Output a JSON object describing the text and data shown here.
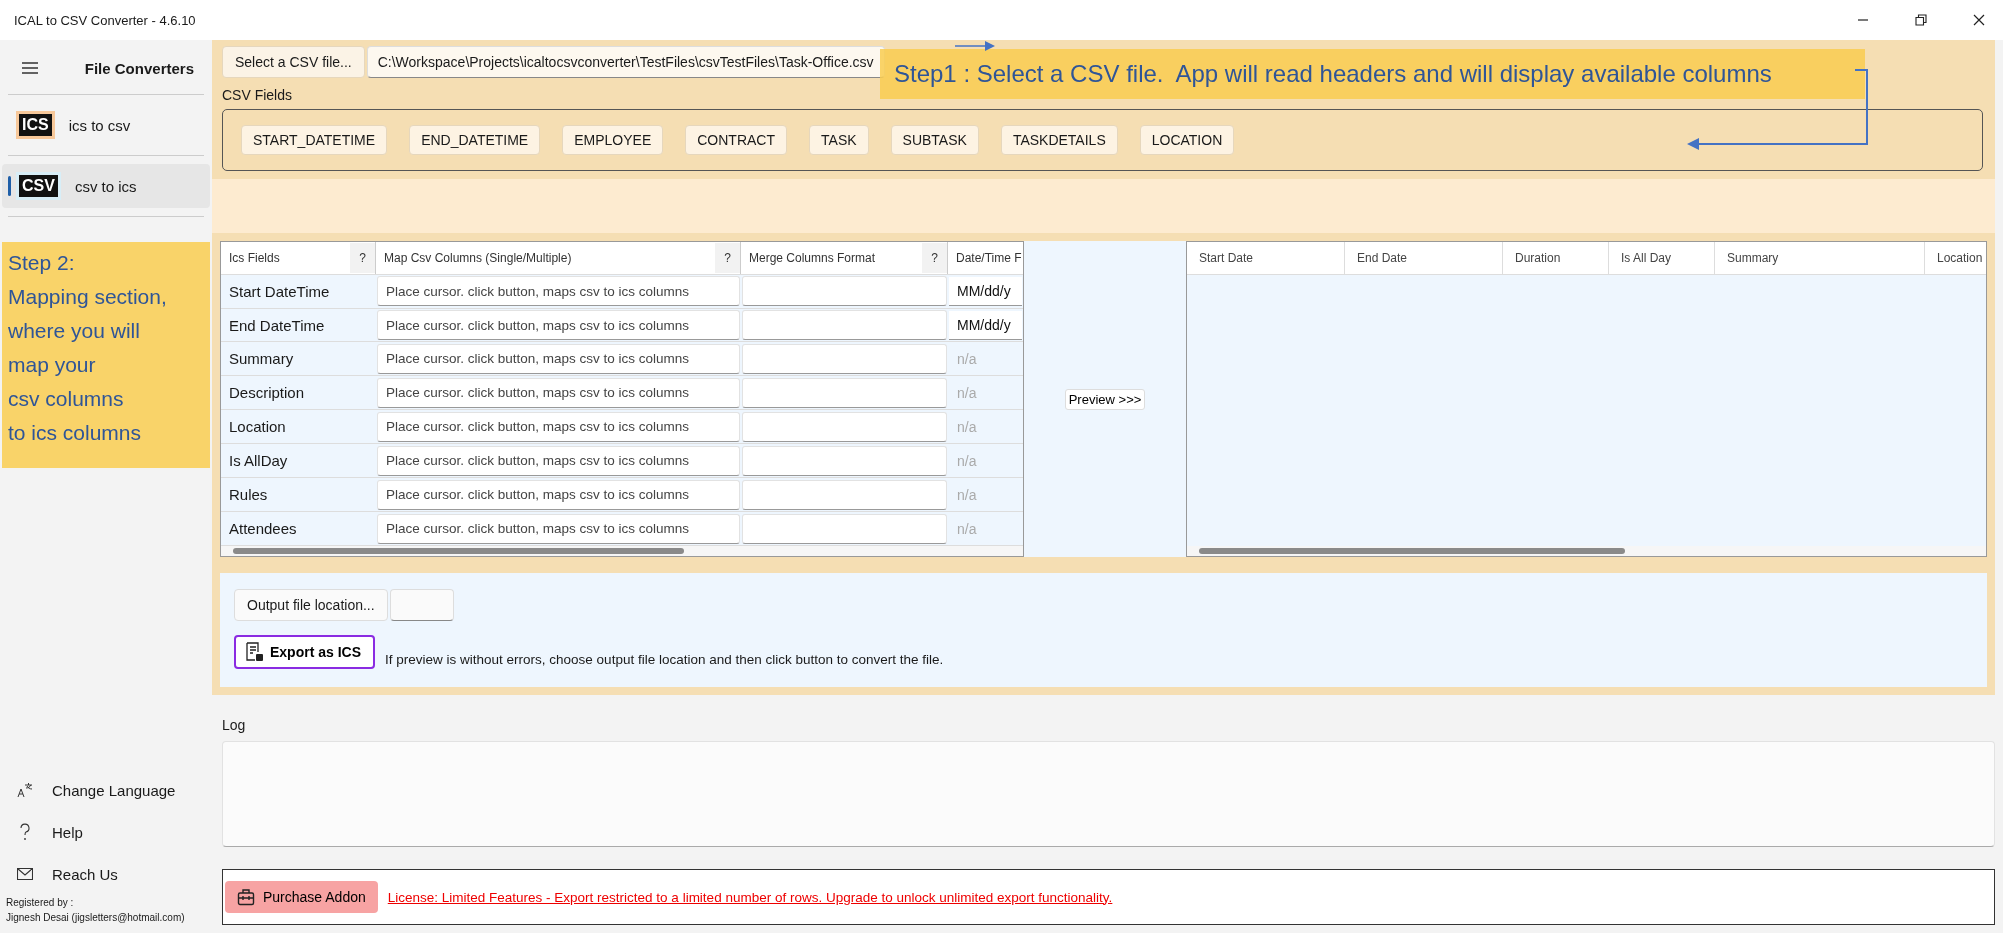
{
  "window": {
    "title": "ICAL to CSV Converter -  4.6.10"
  },
  "sidebar": {
    "title": "File Converters",
    "items": [
      {
        "label": "ics to csv",
        "badge": "ICS",
        "selected": false
      },
      {
        "label": "csv to ics",
        "badge": "CSV",
        "selected": true
      }
    ],
    "footer_items": [
      "Change Language",
      "Help",
      "Reach Us"
    ],
    "registered": [
      "Registered by :",
      "Jignesh Desai (jigsletters@hotmail.com)"
    ]
  },
  "file": {
    "button": "Select a CSV file...",
    "path": "C:\\Workspace\\Projects\\icaltocsvconverter\\TestFiles\\csvTestFiles\\Task-Office.csv"
  },
  "csv_fields": {
    "label": "CSV Fields",
    "chips": [
      "START_DATETIME",
      "END_DATETIME",
      "EMPLOYEE",
      "CONTRACT",
      "TASK",
      "SUBTASK",
      "TASKDETAILS",
      "LOCATION"
    ]
  },
  "callouts": [
    {
      "lines": [
        "Step1 : Select a CSV file.  App will read headers and will display available columns"
      ]
    },
    {
      "lines": [
        "Step 2:",
        "Mapping section,",
        "where you will",
        "map your",
        "csv columns",
        "to ics columns"
      ]
    }
  ],
  "mapping": {
    "columns": [
      {
        "label": "Ics Fields",
        "help": "?"
      },
      {
        "label": "Map Csv Columns (Single/Multiple)",
        "help": "?"
      },
      {
        "label": "Merge Columns Format",
        "help": "?"
      },
      {
        "label": "Date/Time F"
      }
    ],
    "rows": [
      {
        "field": "Start DateTime",
        "placeholder": "Place cursor. click button, maps csv to ics columns",
        "format": "MM/dd/y",
        "disabled": false
      },
      {
        "field": "End DateTime",
        "placeholder": "Place cursor. click button, maps csv to ics columns",
        "format": "MM/dd/y",
        "disabled": false
      },
      {
        "field": "Summary",
        "placeholder": "Place cursor. click button, maps csv to ics columns",
        "format": "n/a",
        "disabled": true
      },
      {
        "field": "Description",
        "placeholder": "Place cursor. click button, maps csv to ics columns",
        "format": "n/a",
        "disabled": true
      },
      {
        "field": "Location",
        "placeholder": "Place cursor. click button, maps csv to ics columns",
        "format": "n/a",
        "disabled": true
      },
      {
        "field": "Is AllDay",
        "placeholder": "Place cursor. click button, maps csv to ics columns",
        "format": "n/a",
        "disabled": true
      },
      {
        "field": "Rules",
        "placeholder": "Place cursor. click button, maps csv to ics columns",
        "format": "n/a",
        "disabled": true
      },
      {
        "field": "Attendees",
        "placeholder": "Place cursor. click button, maps csv to ics columns",
        "format": "n/a",
        "disabled": true
      }
    ]
  },
  "preview": {
    "button": "Preview >>>",
    "columns": [
      "Start Date",
      "End Date",
      "Duration",
      "Is All Day",
      "Summary",
      "Location"
    ]
  },
  "output": {
    "location_button": "Output file location...",
    "export_button": "Export as ICS",
    "hint": "If preview is without errors, choose output file location and then click button to convert the file."
  },
  "log": {
    "label": "Log"
  },
  "license": {
    "button": "Purchase Addon",
    "text": "License: Limited Features - Export restricted to a limited number of rows. Upgrade to unlock unlimited export functionality."
  }
}
